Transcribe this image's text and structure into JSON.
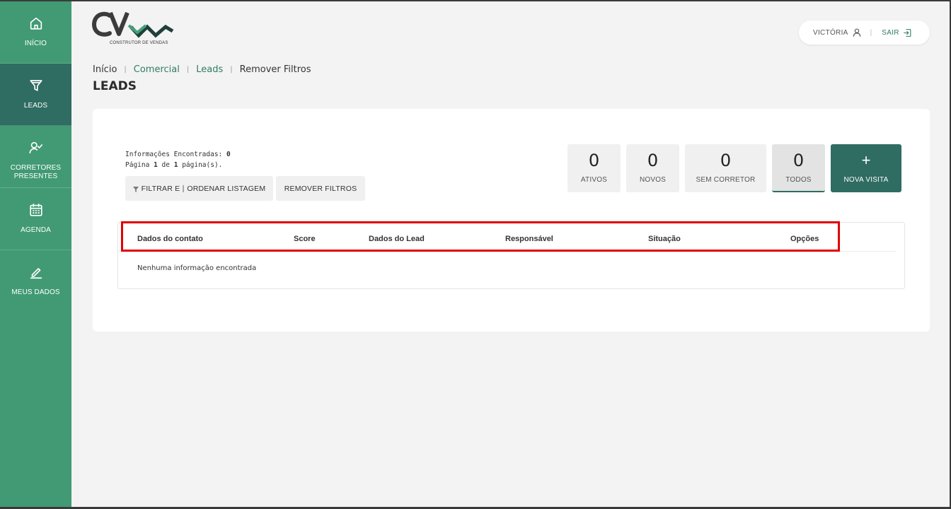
{
  "sidebar": {
    "items": [
      {
        "label": "INÍCIO",
        "icon": "home-icon"
      },
      {
        "label": "LEADS",
        "icon": "funnel-icon"
      },
      {
        "label": "CORRETORES\nPRESENTES",
        "icon": "user-check-icon"
      },
      {
        "label": "AGENDA",
        "icon": "calendar-icon"
      },
      {
        "label": "MEUS DADOS",
        "icon": "edit-icon"
      }
    ]
  },
  "logo": {
    "subtitle": "CONSTRUTOR DE VENDAS"
  },
  "user": {
    "name": "VICTÓRIA",
    "separator": "|",
    "logout_label": "SAIR"
  },
  "breadcrumb": {
    "items": [
      "Início",
      "Comercial",
      "Leads",
      "Remover Filtros"
    ],
    "separator": "|"
  },
  "page_title": "LEADS",
  "info": {
    "found_label": "Informações Encontradas:",
    "found_count": "0",
    "page_label": "Página",
    "page_current": "1",
    "page_of": "de",
    "page_total": "1",
    "page_suffix": "página(s)."
  },
  "buttons": {
    "filter_label_1": "FILTRAR E",
    "filter_label_2": "ORDENAR LISTAGEM",
    "remove_filters": "REMOVER FILTROS"
  },
  "counters": [
    {
      "value": "0",
      "label": "ATIVOS"
    },
    {
      "value": "0",
      "label": "NOVOS"
    },
    {
      "value": "0",
      "label": "SEM CORRETOR"
    },
    {
      "value": "0",
      "label": "TODOS"
    }
  ],
  "new_visit": {
    "symbol": "+",
    "label": "NOVA VISITA"
  },
  "table": {
    "columns": [
      "Dados do contato",
      "Score",
      "Dados do Lead",
      "Responsável",
      "Situação",
      "Opções"
    ],
    "empty_message": "Nenhuma informação encontrada"
  },
  "colors": {
    "sidebar": "#419a74",
    "sidebar_active": "#2f6c62",
    "accent": "#2f7d62",
    "highlight": "#e00000"
  }
}
